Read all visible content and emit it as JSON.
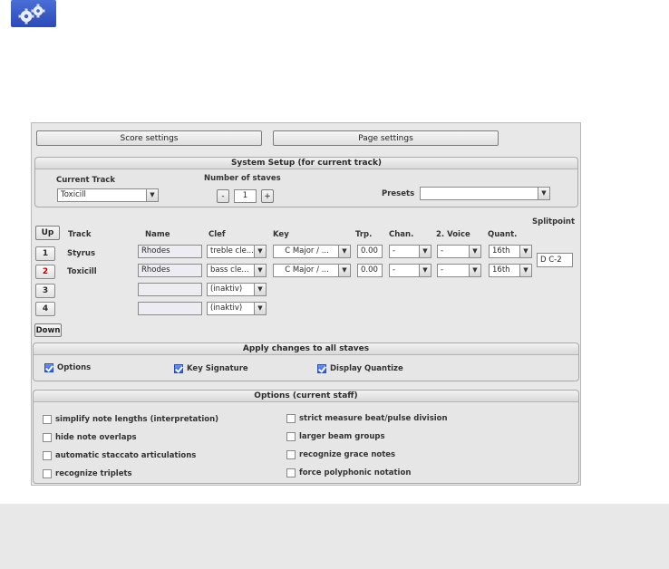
{
  "header": {
    "icon": "gears-icon"
  },
  "tabs": {
    "score_settings": "Score settings",
    "page_settings": "Page settings"
  },
  "system_setup": {
    "title": "System Setup (for current track)",
    "current_track_label": "Current Track",
    "current_track_value": "Toxicill",
    "stave_count_label": "Number of staves",
    "stave_count_value": "1",
    "minus_label": "-",
    "plus_label": "+",
    "presets_label": "Presets",
    "presets_value": ""
  },
  "tracks": {
    "up_label": "Up",
    "down_label": "Down",
    "splitpoint_label": "Splitpoint",
    "splitpoint_value": "D C-2",
    "headers": {
      "track": "Track",
      "name": "Name",
      "clef": "Clef",
      "key": "Key",
      "trp": "Trp.",
      "chan": "Chan.",
      "voice2": "2. Voice",
      "quant": "Quant."
    },
    "rows": [
      {
        "num": "1",
        "track": "Styrus",
        "name": "Rhodes",
        "clef": "treble cle...",
        "key": "C Major / ...",
        "trp": "0.00",
        "chan": "-",
        "voice2": "-",
        "quant": "16th"
      },
      {
        "num": "2",
        "track": "Toxicill",
        "name": "Rhodes",
        "clef": "bass cle...",
        "key": "C Major / ...",
        "trp": "0.00",
        "chan": "-",
        "voice2": "-",
        "quant": "16th"
      },
      {
        "num": "3",
        "track": "",
        "name": "",
        "clef": "(inaktiv)"
      },
      {
        "num": "4",
        "track": "",
        "name": "",
        "clef": "(inaktiv)"
      }
    ]
  },
  "apply_all": {
    "title": "Apply changes to all staves",
    "options": "Options",
    "key_signature": "Key Signature",
    "display_quantize": "Display Quantize"
  },
  "options": {
    "title": "Options (current staff)",
    "left": [
      "simplify note lengths (interpretation)",
      "hide note overlaps",
      "automatic staccato articulations",
      "recognize triplets"
    ],
    "right": [
      "strict measure beat/pulse division",
      "larger beam groups",
      "recognize grace notes",
      "force polyphonic notation"
    ]
  },
  "colors": {
    "accent": "#2d5ce0",
    "track_highlight": "#c00000"
  }
}
